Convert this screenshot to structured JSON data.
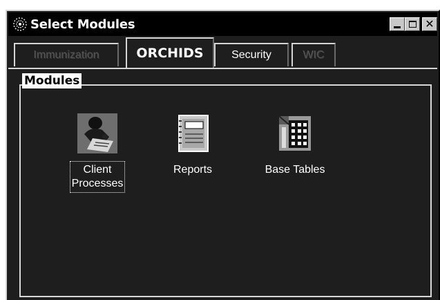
{
  "window": {
    "title": "Select Modules",
    "icon": "gear-dots-icon",
    "controls": {
      "minimize": "minimize-icon",
      "maximize": "maximize-icon",
      "close": "close-icon"
    }
  },
  "tabs": [
    {
      "label": "Immunization",
      "state": "disabled"
    },
    {
      "label": "ORCHIDS",
      "state": "selected"
    },
    {
      "label": "Security",
      "state": "enabled"
    },
    {
      "label": "WIC",
      "state": "disabled"
    }
  ],
  "group": {
    "label": "Modules"
  },
  "modules": [
    {
      "label_line1": "Client",
      "label_line2": "Processes",
      "icon": "client-person-icon",
      "focused": true
    },
    {
      "label_line1": "Reports",
      "icon": "notebook-icon"
    },
    {
      "label_line1": "Base Tables",
      "icon": "table-grid-icon"
    }
  ],
  "colors": {
    "window_bg": "#1e1e1e",
    "titlebar_bg": "#000000",
    "text": "#ffffff",
    "disabled_text": "#555555"
  }
}
